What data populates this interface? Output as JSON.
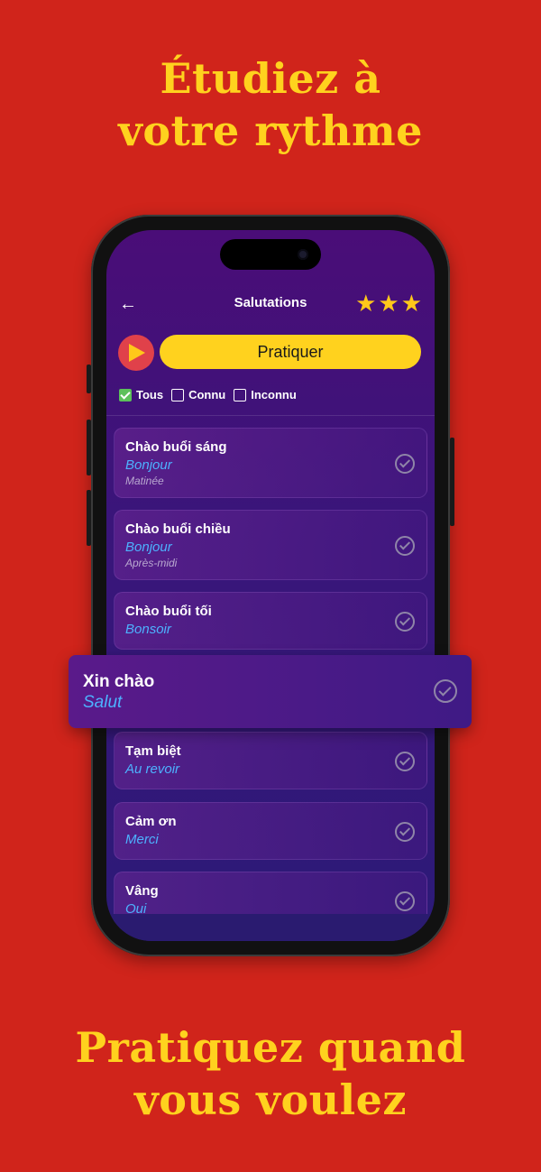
{
  "headline_top": "Étudiez à votre rythme",
  "headline_bottom": "Pratiquez quand vous voulez",
  "app": {
    "title": "Salutations",
    "stars": 3,
    "play_icon": "play-icon",
    "practice_label": "Pratiquer",
    "filters": [
      {
        "label": "Tous",
        "checked": true
      },
      {
        "label": "Connu",
        "checked": false
      },
      {
        "label": "Inconnu",
        "checked": false
      }
    ],
    "items": [
      {
        "vi": "Chào buổi sáng",
        "fr": "Bonjour",
        "note": "Matinée"
      },
      {
        "vi": "Chào buổi chiều",
        "fr": "Bonjour",
        "note": "Après-midi"
      },
      {
        "vi": "Chào buổi tối",
        "fr": "Bonsoir",
        "note": ""
      },
      {
        "vi": "Xin chào",
        "fr": "Salut",
        "note": ""
      },
      {
        "vi": "Tạm biệt",
        "fr": "Au revoir",
        "note": ""
      },
      {
        "vi": "Cảm ơn",
        "fr": "Merci",
        "note": ""
      },
      {
        "vi": "Vâng",
        "fr": "Oui",
        "note": ""
      }
    ]
  },
  "colors": {
    "background": "#d0241b",
    "headline": "#ffd21e",
    "accent_yellow": "#ffd21e",
    "translation_blue": "#4db2ff"
  }
}
